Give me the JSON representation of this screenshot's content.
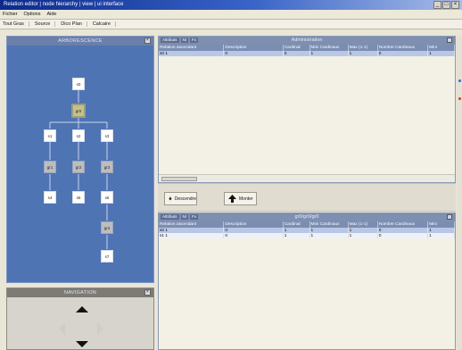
{
  "window": {
    "title": "Relation editor | node hierarchy | view | ui interface"
  },
  "menu": [
    "Fichier",
    "Options",
    "Aide"
  ],
  "toolbar": [
    "Tout Gras",
    "Source",
    "Dico Plan",
    "Calcaire"
  ],
  "left_panel": {
    "title": "ARBORESCENCE",
    "nodes": [
      {
        "label": "s0",
        "style": "white"
      },
      {
        "label": "gr0",
        "style": "selected"
      },
      {
        "label": "s1",
        "style": "white"
      },
      {
        "label": "s2",
        "style": "white"
      },
      {
        "label": "s3",
        "style": "white"
      },
      {
        "label": "gr1",
        "style": "gray"
      },
      {
        "label": "gr2",
        "style": "gray"
      },
      {
        "label": "gr3",
        "style": "gray"
      },
      {
        "label": "s4",
        "style": "white"
      },
      {
        "label": "s5",
        "style": "white"
      },
      {
        "label": "s6",
        "style": "white"
      },
      {
        "label": "gr4",
        "style": "gray"
      },
      {
        "label": "s7",
        "style": "white"
      }
    ]
  },
  "nav_panel": {
    "title": "NAVIGATION"
  },
  "top_table": {
    "tabs": [
      "Attributs",
      "Nt",
      "Fx"
    ],
    "title": "Administration",
    "columns": [
      "Relation ascendant",
      "Description",
      "Cardinal",
      "Mini Cardinaux",
      "Max (1-1)",
      "Nombre Cardinaux",
      "Mini"
    ],
    "rows": [
      [
        "s0 1",
        "tr",
        "0",
        "1",
        "1",
        "0",
        "1"
      ]
    ]
  },
  "buttons": {
    "down_label": "Descendre",
    "up_label": "Monter"
  },
  "bottom_table": {
    "tabs": [
      "Attributs",
      "Nt",
      "Fx"
    ],
    "title": "gr0/gr0/gr0",
    "columns": [
      "Relation ascendant",
      "Description",
      "Cardinal",
      "Mini Cardinaux",
      "Max (1-1)",
      "Nombre Cardinaux",
      "Mini"
    ],
    "rows": [
      [
        "s0 1",
        "tr",
        "1",
        "1",
        "1",
        "0",
        "1"
      ],
      [
        "s1 1",
        "tr",
        "1",
        "1",
        "1",
        "0",
        "1"
      ]
    ]
  },
  "colors": {
    "tree_bg": "#4f74b4",
    "accent": "#7a8db3"
  }
}
